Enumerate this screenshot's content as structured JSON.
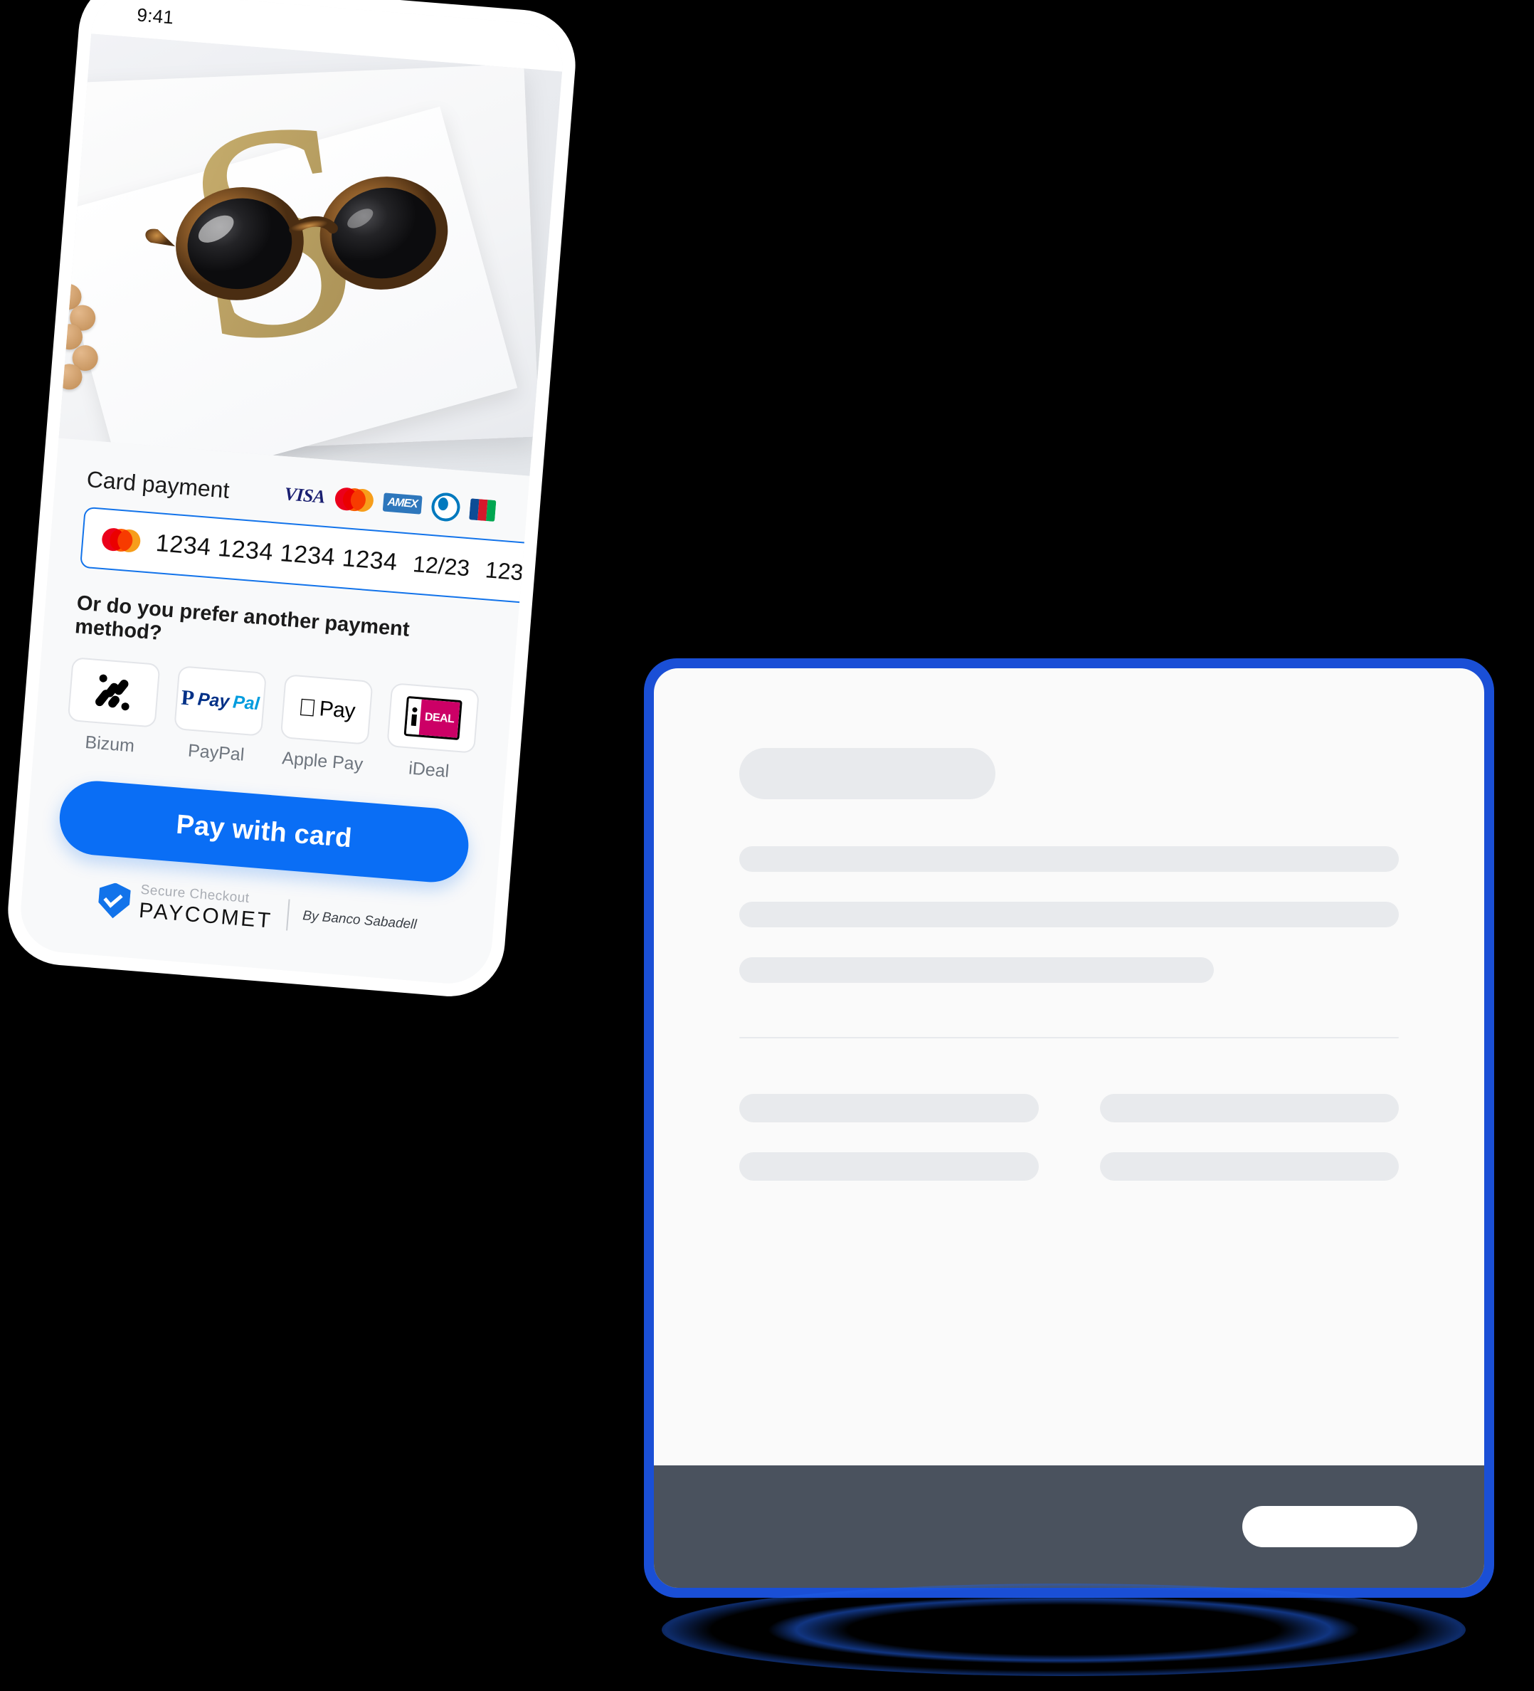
{
  "phone": {
    "status_bar": {
      "time": "9:41"
    },
    "product_image": {
      "alt": "sunglasses on gold letter card",
      "icon": "sunglasses-icon"
    },
    "checkout": {
      "card_payment_title": "Card payment",
      "accepted_brands": [
        {
          "name": "VISA",
          "icon": "visa-icon"
        },
        {
          "name": "Mastercard",
          "icon": "mastercard-icon"
        },
        {
          "name": "AMEX",
          "icon": "amex-icon"
        },
        {
          "name": "Diners Club",
          "icon": "diners-icon"
        },
        {
          "name": "JCB",
          "icon": "jcb-icon"
        }
      ],
      "card_field": {
        "brand_icon": "mastercard-icon",
        "number": "1234 1234 1234 1234",
        "expiry": "12/23",
        "cvc": "123"
      },
      "alt_methods_title": "Or do you prefer another payment method?",
      "methods": [
        {
          "label": "Bizum",
          "icon": "bizum-icon"
        },
        {
          "label": "PayPal",
          "icon": "paypal-icon",
          "brand_part1": "Pay",
          "brand_part2": "Pal",
          "mark": "P"
        },
        {
          "label": "Apple Pay",
          "icon": "apple-pay-icon",
          "mark": "",
          "word": "Pay"
        },
        {
          "label": "iDeal",
          "icon": "ideal-icon",
          "mark": "DEAL"
        }
      ],
      "pay_button_label": "Pay with card",
      "footer": {
        "secure_checkout": "Secure Checkout",
        "wordmark": "PAYCOMET",
        "provider": "By Banco Sabadell",
        "shield_icon": "shield-check-icon"
      }
    }
  },
  "browser_panel": {
    "accent_color": "#1a4fd6",
    "footer_color": "#4a525e",
    "skeleton": {
      "title_block": true,
      "lines": [
        {
          "width": "100%"
        },
        {
          "width": "100%"
        },
        {
          "width": "72%"
        }
      ],
      "grid_blocks": [
        "a",
        "b",
        "c",
        "d"
      ],
      "footer_button": true
    }
  },
  "colors": {
    "primary_blue": "#0a6ef5",
    "panel_blue": "#1a4fd6",
    "visa_blue": "#1a4f95",
    "mastercard_red": "#eb001b",
    "mastercard_yellow": "#f79e1b",
    "ideal_pink": "#cc0066",
    "paypal_dark": "#003087",
    "paypal_light": "#009cde"
  }
}
